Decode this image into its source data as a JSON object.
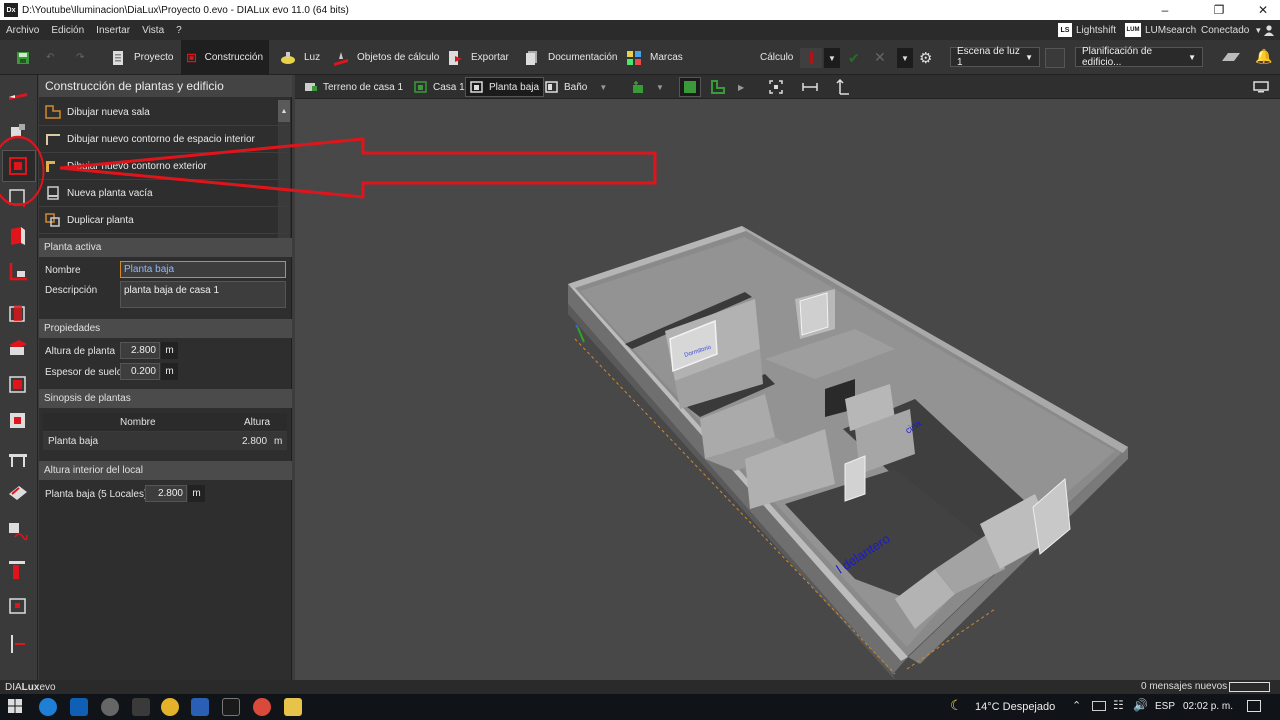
{
  "window": {
    "title": "D:\\Youtube\\Iluminacion\\DiaLux\\Proyecto 0.evo - DIALux evo 11.0  (64 bits)",
    "app_icon": "Dx"
  },
  "menu": {
    "items": [
      "Archivo",
      "Edición",
      "Insertar",
      "Vista",
      "?"
    ],
    "lightshift": "Lightshift",
    "lumsearch": "LUMsearch",
    "lumsearch_badge": "LUM",
    "lightshift_badge": "LS",
    "connected": "Conectado"
  },
  "toolbar": {
    "tabs": [
      "Proyecto",
      "Construcción",
      "Luz",
      "Objetos de cálculo",
      "Exportar",
      "Documentación",
      "Marcas"
    ],
    "active_tab": "Construcción",
    "calc_label": "Cálculo",
    "scene": "Escena de luz 1",
    "plan": "Planificación de edificio..."
  },
  "panel": {
    "header": "Construcción de plantas y edificio",
    "actions": [
      "Dibujar nueva sala",
      "Dibujar nuevo contorno de espacio interior",
      "Dibujar nuevo contorno exterior",
      "Nueva planta vacía",
      "Duplicar planta"
    ],
    "active_floor": {
      "header": "Planta activa",
      "name_label": "Nombre",
      "name_value": "Planta baja",
      "desc_label": "Descripción",
      "desc_value": "planta baja de casa 1"
    },
    "properties": {
      "header": "Propiedades",
      "height_label": "Altura de planta",
      "height_value": "2.800",
      "floor_label": "Espesor de suelo",
      "floor_value": "0.200",
      "unit": "m"
    },
    "synopsis": {
      "header": "Sinopsis de plantas",
      "col_name": "Nombre",
      "col_height": "Altura",
      "rows": [
        {
          "name": "Planta baja",
          "height": "2.800",
          "unit": "m"
        }
      ]
    },
    "interior": {
      "header": "Altura interior del local",
      "label": "Planta baja (5 Locales)",
      "value": "2.800",
      "unit": "m"
    }
  },
  "viewport": {
    "breadcrumbs": [
      "Terreno  de casa 1",
      "Casa 1",
      "Planta baja",
      "Baño"
    ],
    "room_label_1": "l delantero",
    "room_label_2": "cina",
    "room_label_3": "Dormitorio"
  },
  "status": {
    "brand_a": "DIA",
    "brand_b": "Lux",
    "brand_c": "evo",
    "messages": "0 mensajes nuevos"
  },
  "taskbar": {
    "weather": "14°C  Despejado",
    "lang": "ESP",
    "time": "02:02 p. m."
  },
  "colors": {
    "accent_red": "#e0151b",
    "orange": "#d08a2e",
    "green": "#2fa52f"
  }
}
